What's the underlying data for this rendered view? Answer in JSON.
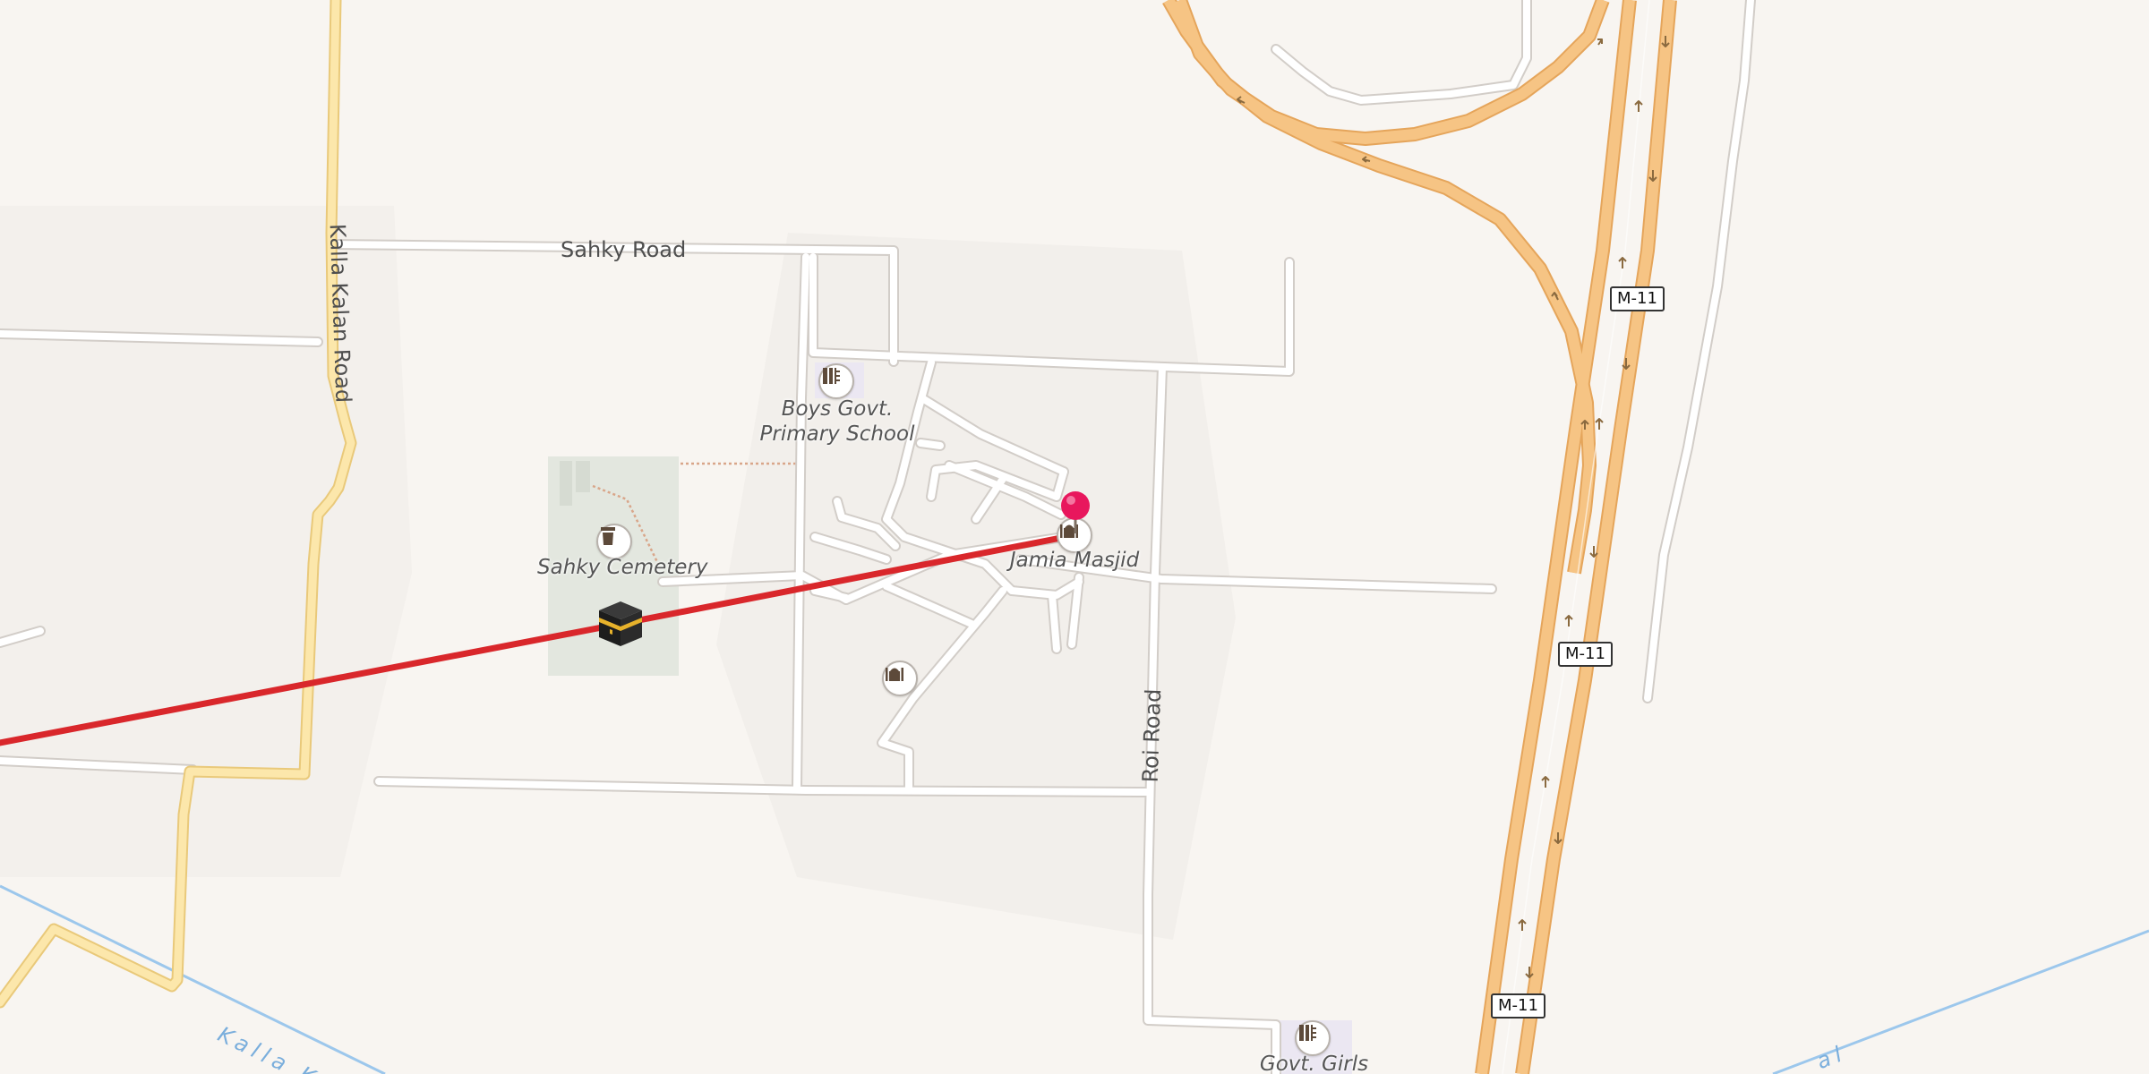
{
  "map": {
    "roads": {
      "sahky_road": "Sahky Road",
      "kalla_kalan_road": "Kalla Kalan Road",
      "roi_road": "Roi Road"
    },
    "shields": [
      "M-11",
      "M-11",
      "M-11"
    ],
    "pois": {
      "school_1": "Boys Govt.\nPrimary School",
      "cemetery": "Sahky Cemetery",
      "mosque": "Jamia Masjid",
      "school_2": "Govt. Girls"
    },
    "water": {
      "canal_left": "Kalla Kala",
      "canal_right": "al"
    },
    "icons": {
      "school": "school-icon",
      "cemetery": "cemetery-icon",
      "mosque": "mosque-icon",
      "kaaba": "kaaba-icon",
      "pin": "location-pin-icon"
    },
    "colors": {
      "background": "#f8f5f1",
      "motorway": "#f6c484",
      "secondary": "#fbe3a6",
      "qibla_line": "#d9272b",
      "pin": "#e8175d",
      "water": "#9cc7ec"
    }
  }
}
